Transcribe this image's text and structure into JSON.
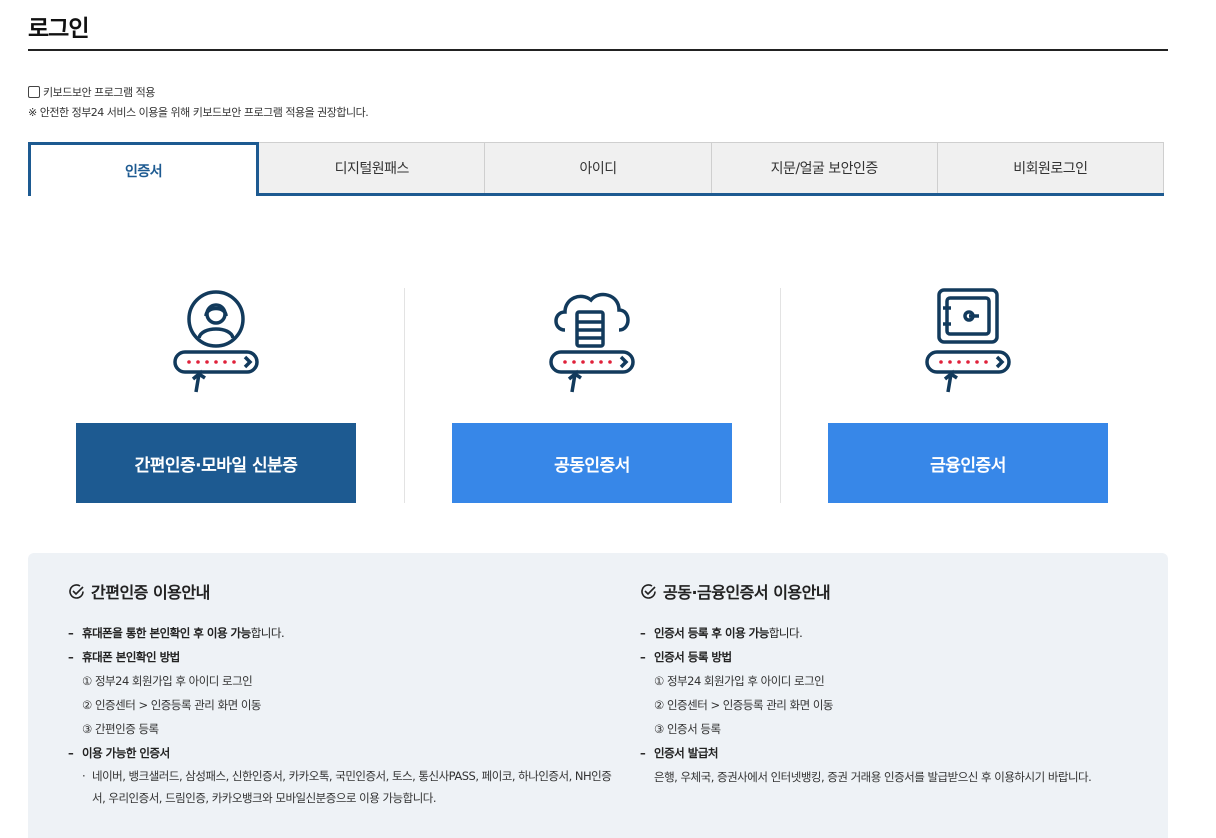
{
  "page": {
    "title": "로그인"
  },
  "keyboard": {
    "checkbox_label": "키보드보안 프로그램 적용",
    "note": "※ 안전한 정부24 서비스 이용을 위해 키보드보안 프로그램 적용을 권장합니다."
  },
  "tabs": [
    {
      "label": "인증서",
      "active": true
    },
    {
      "label": "디지털원패스"
    },
    {
      "label": "아이디"
    },
    {
      "label": "지문/얼굴 보안인증"
    },
    {
      "label": "비회원로그인"
    }
  ],
  "cards": [
    {
      "button": "간편인증·모바일 신분증",
      "icon": "user-password-icon"
    },
    {
      "button": "공동인증서",
      "icon": "cloud-server-password-icon"
    },
    {
      "button": "금융인증서",
      "icon": "safe-password-icon"
    }
  ],
  "guide": {
    "left": {
      "title": "간편인증 이용안내",
      "items": [
        {
          "strong": "휴대폰을 통한 본인확인 후 이용 가능",
          "rest": "합니다."
        },
        {
          "head": "휴대폰 본인확인 방법"
        },
        {
          "sub": "① 정부24 회원가입 후 아이디 로그인"
        },
        {
          "sub": "② 인증센터 > 인증등록 관리 화면 이동"
        },
        {
          "sub": "③ 간편인증 등록"
        },
        {
          "head": "이용 가능한 인증서"
        },
        {
          "bullet_line1": "네이버, 뱅크샐러드, 삼성패스, 신한인증서, 카카오톡, 국민인증서, 토스, 통신사PASS, 페이코, 하나인증서, NH인증",
          "bullet_line2": "서, 우리인증서, 드림인증, 카카오뱅크와 모바일신분증으로 이용 가능합니다."
        }
      ]
    },
    "right": {
      "title": "공동·금융인증서 이용안내",
      "items": [
        {
          "strong": "인증서 등록 후 이용 가능",
          "rest": "합니다."
        },
        {
          "head": "인증서 등록 방법"
        },
        {
          "sub": "① 정부24 회원가입 후 아이디 로그인"
        },
        {
          "sub": "② 인증센터 > 인증등록 관리 화면 이동"
        },
        {
          "sub": "③ 인증서 등록"
        },
        {
          "head": "인증서 발급처"
        },
        {
          "plain": "은행, 우체국, 증권사에서 인터넷뱅킹, 증권 거래용 인증서를 발급받으신 후 이용하시기 바랍니다."
        }
      ]
    }
  },
  "colors": {
    "primary": "#1d5a91",
    "accent": "#3787e8",
    "guide_bg": "#eef2f6"
  }
}
